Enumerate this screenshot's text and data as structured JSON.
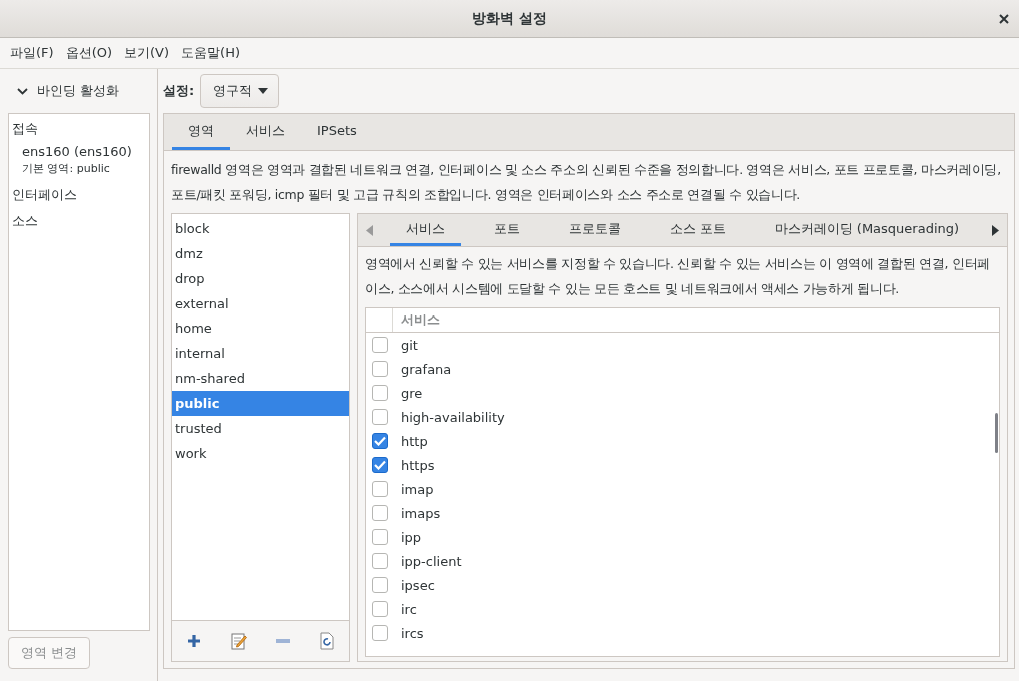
{
  "window": {
    "title": "방화벽 설정"
  },
  "menu": [
    "파일(F)",
    "옵션(O)",
    "보기(V)",
    "도움말(H)"
  ],
  "sidebar": {
    "binding": {
      "label": "바인딩 활성화",
      "expanded": true
    },
    "connections_heading": "접속",
    "connections": [
      {
        "name": "ens160 (ens160)",
        "zone": "기본 영역: public"
      }
    ],
    "interfaces_heading": "인터페이스",
    "sources_heading": "소스",
    "change_zone_button": {
      "label": "영역 변경",
      "disabled": true
    }
  },
  "config": {
    "label": "설정:",
    "value": "영구적"
  },
  "tabs": [
    {
      "label": "영역",
      "selected": true
    },
    {
      "label": "서비스",
      "selected": false
    },
    {
      "label": "IPSets",
      "selected": false
    }
  ],
  "description": "firewalld 영역은 영역과 결합된 네트워크 연결, 인터페이스 및 소스 주소의 신뢰된 수준을 정의합니다. 영역은 서비스, 포트 프로토콜, 마스커레이딩, 포트/패킷 포워딩, icmp 필터 및 고급 규칙의 조합입니다. 영역은 인터페이스와 소스 주소로 연결될 수 있습니다.",
  "zones": [
    {
      "name": "block",
      "selected": false
    },
    {
      "name": "dmz",
      "selected": false
    },
    {
      "name": "drop",
      "selected": false
    },
    {
      "name": "external",
      "selected": false
    },
    {
      "name": "home",
      "selected": false
    },
    {
      "name": "internal",
      "selected": false
    },
    {
      "name": "nm-shared",
      "selected": false
    },
    {
      "name": "public",
      "selected": true
    },
    {
      "name": "trusted",
      "selected": false
    },
    {
      "name": "work",
      "selected": false
    }
  ],
  "zone_tabs": [
    {
      "label": "서비스",
      "selected": true
    },
    {
      "label": "포트",
      "selected": false
    },
    {
      "label": "프로토콜",
      "selected": false
    },
    {
      "label": "소스 포트",
      "selected": false
    },
    {
      "label": "마스커레이딩 (Masquerading)",
      "selected": false
    }
  ],
  "services_description": "영역에서 신뢰할 수 있는 서비스를 지정할 수 있습니다. 신뢰할 수 있는 서비스는 이 영역에 결합된 연결, 인터페이스, 소스에서 시스템에 도달할 수 있는 모든 호스트 및 네트워크에서 액세스 가능하게 됩니다.",
  "services_header": "서비스",
  "services": [
    {
      "name": "git",
      "checked": false
    },
    {
      "name": "grafana",
      "checked": false
    },
    {
      "name": "gre",
      "checked": false
    },
    {
      "name": "high-availability",
      "checked": false
    },
    {
      "name": "http",
      "checked": true
    },
    {
      "name": "https",
      "checked": true
    },
    {
      "name": "imap",
      "checked": false
    },
    {
      "name": "imaps",
      "checked": false
    },
    {
      "name": "ipp",
      "checked": false
    },
    {
      "name": "ipp-client",
      "checked": false
    },
    {
      "name": "ipsec",
      "checked": false
    },
    {
      "name": "irc",
      "checked": false
    },
    {
      "name": "ircs",
      "checked": false
    }
  ]
}
